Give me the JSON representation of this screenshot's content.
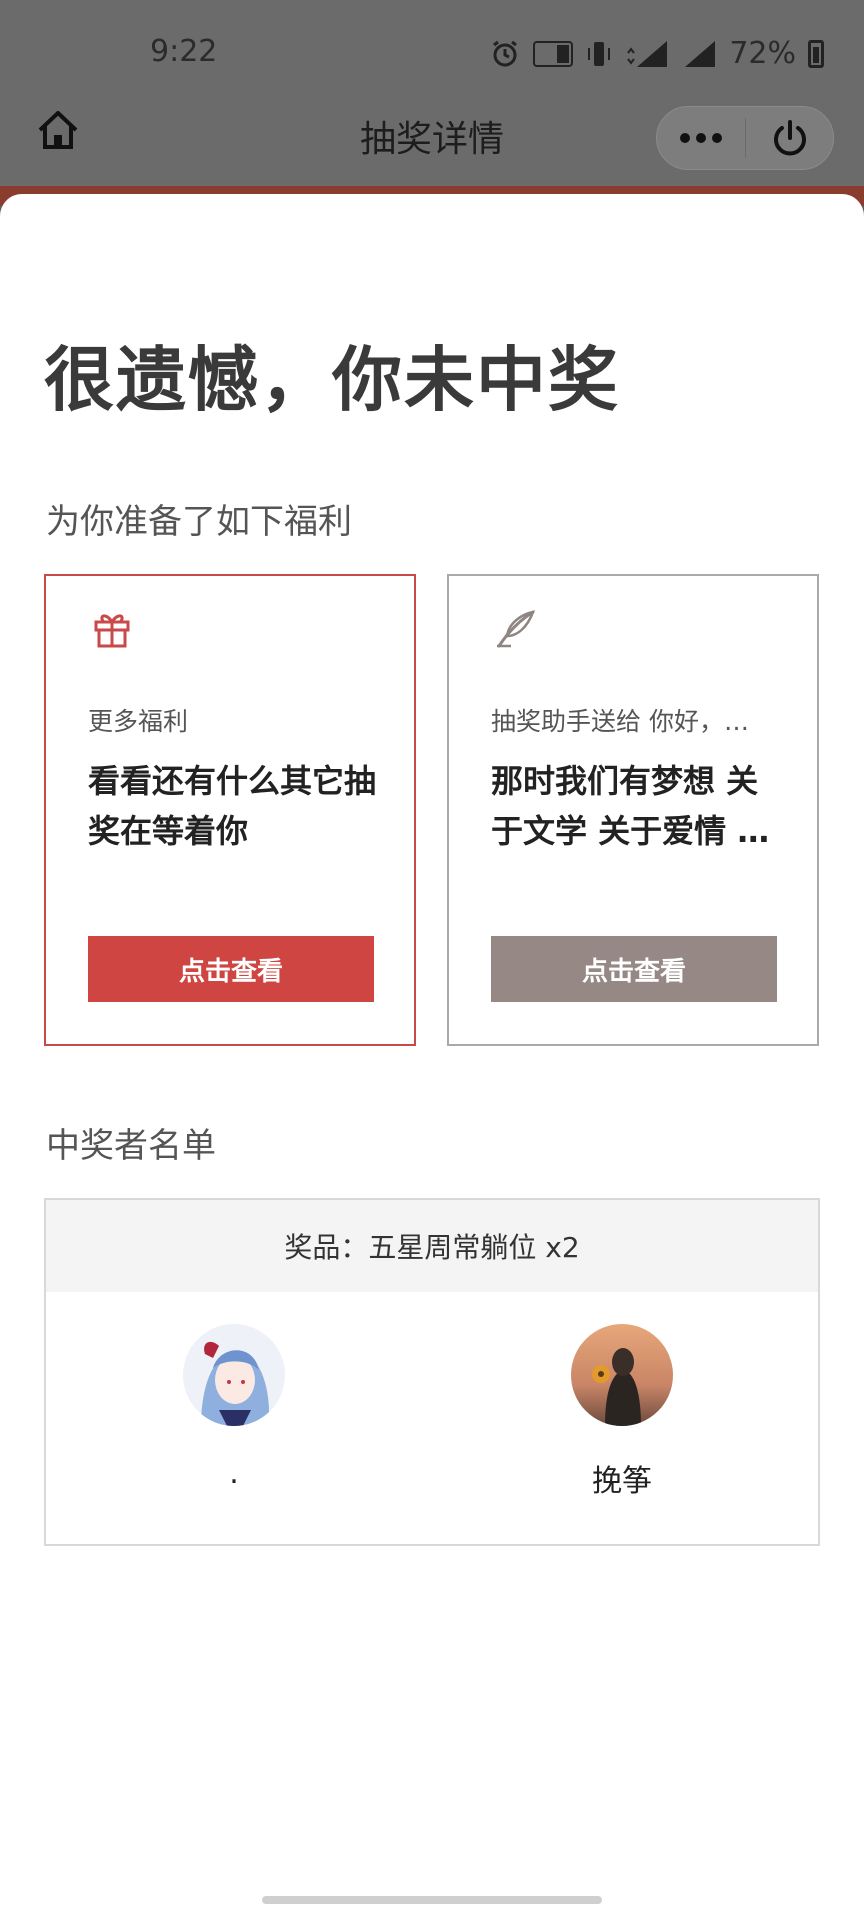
{
  "status_bar": {
    "time": "9:22",
    "battery_pct": "72%",
    "icons": [
      "alarm-icon",
      "volte-icon",
      "vibrate-icon",
      "signal-4g-icon",
      "signal-4g-icon",
      "battery-icon"
    ]
  },
  "nav": {
    "title": "抽奖详情",
    "home_icon": "home-icon",
    "more_icon": "more-dots-icon",
    "close_icon": "power-icon"
  },
  "result": {
    "headline": "很遗憾，你未中奖"
  },
  "benefits": {
    "section_label": "为你准备了如下福利",
    "cards": [
      {
        "icon": "gift-icon",
        "subtitle": "更多福利",
        "title": "看看还有什么其它抽奖在等着你",
        "button": "点击查看",
        "accent": "#cf4541"
      },
      {
        "icon": "feather-icon",
        "subtitle": "抽奖助手送给 你好，…",
        "title": "那时我们有梦想 关于文学 关于爱情 …",
        "button": "点击查看",
        "accent": "#968885"
      }
    ]
  },
  "winners": {
    "section_label": "中奖者名单",
    "prize": "奖品：五星周常躺位 x2",
    "list": [
      {
        "name": "."
      },
      {
        "name": "挽筝"
      }
    ]
  }
}
